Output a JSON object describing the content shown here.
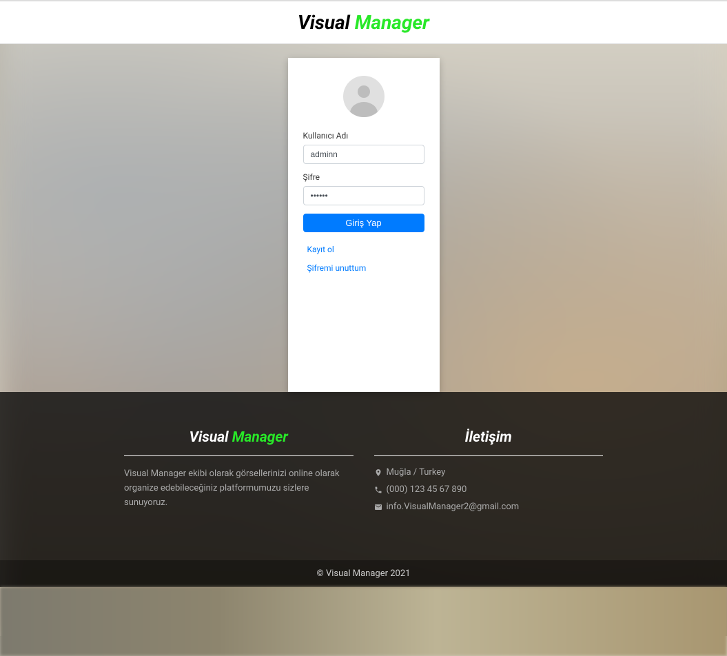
{
  "header": {
    "title_first": "Visual",
    "title_second": "Manager"
  },
  "login": {
    "username_label": "Kullanıcı Adı",
    "username_value": "adminn",
    "password_label": "Şifre",
    "password_value": "••••••",
    "submit_label": "Giriş Yap",
    "register_link": "Kayıt ol",
    "forgot_link": "Şifremi unuttum"
  },
  "footer": {
    "brand_first": "Visual",
    "brand_second": "Manager",
    "about_text": "Visual Manager ekibi olarak görsellerinizi online olarak organize edebileceğiniz platformumuzu sizlere sunuyoruz.",
    "contact_heading": "İletişim",
    "location": "Muğla / Turkey",
    "phone": "(000) 123 45 67 890",
    "email": "info.VisualManager2@gmail.com",
    "copyright": "© Visual Manager 2021"
  }
}
